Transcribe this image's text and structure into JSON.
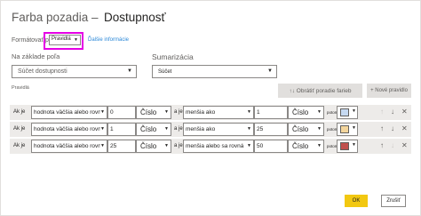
{
  "dialog": {
    "title": "Farba pozadia –",
    "subtitle": "Dostupnosť"
  },
  "format": {
    "label": "Formátovať podľa",
    "selected": "Pravidlá",
    "more_link": "Ďalšie informácie"
  },
  "based_on": {
    "label": "Na základe poľa",
    "selected": "Súčet dostupnosti"
  },
  "summarization": {
    "label": "Sumarizácia",
    "selected": "Súčet"
  },
  "rules": {
    "label": "Pravidlá",
    "reverse_label": "↑↓  Obrátiť poradie farieb",
    "new_rule_label": "+ Nové pravidlo",
    "items": [
      {
        "prefix": "Ak je",
        "cond1": "hodnota väčšia alebo rovná",
        "val1": "0",
        "unit1": "Číslo",
        "mid": "a je",
        "cond2": "menšia ako",
        "val2": "1",
        "unit2": "Číslo",
        "then": "potom",
        "color": "#c6d9f1",
        "up_enabled": false,
        "down_enabled": true
      },
      {
        "prefix": "Ak je",
        "cond1": "hodnota väčšia alebo rovná",
        "val1": "1",
        "unit1": "Číslo",
        "mid": "a je",
        "cond2": "menšia ako",
        "val2": "25",
        "unit2": "Číslo",
        "then": "potom",
        "color": "#f3d59c",
        "up_enabled": true,
        "down_enabled": true
      },
      {
        "prefix": "Ak je",
        "cond1": "hodnota väčšia alebo rovná",
        "val1": "25",
        "unit1": "Číslo",
        "mid": "a je",
        "cond2": "menšia alebo sa rovná",
        "val2": "50",
        "unit2": "Číslo",
        "then": "potom",
        "color": "#c0504d",
        "up_enabled": true,
        "down_enabled": false
      }
    ]
  },
  "footer": {
    "ok_label": "OK",
    "cancel_label": "Zrušiť"
  },
  "colors": {
    "accent_ok": "#f2c811",
    "highlight": "#e500e5",
    "link": "#2b88d8"
  }
}
